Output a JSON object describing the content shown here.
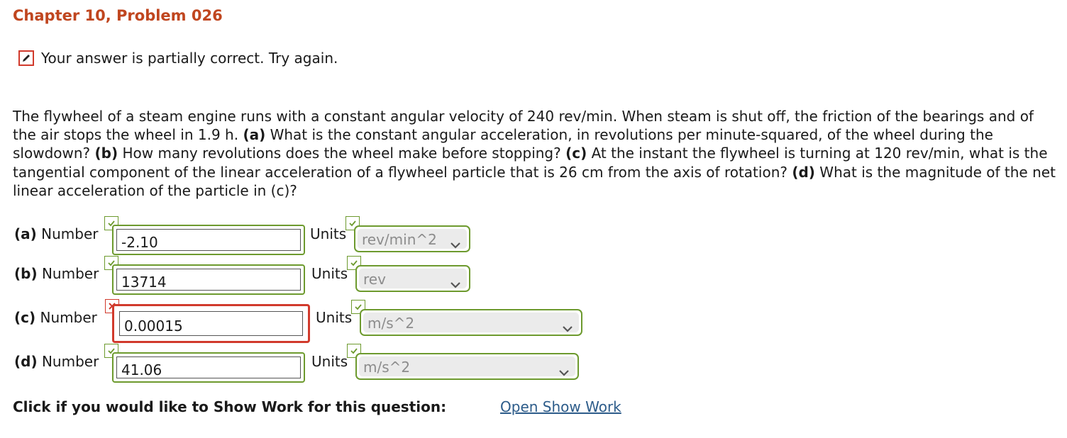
{
  "header": {
    "title": "Chapter 10, Problem 026"
  },
  "status": {
    "message": "Your answer is partially correct.  Try again.",
    "icon": "pencil-icon",
    "color": "#d13a2c"
  },
  "problem": {
    "s1": "The flywheel of a steam engine runs with a constant angular velocity of 240 rev/min. When steam is shut off, the friction of the bearings and of the air stops the wheel in 1.9 h. ",
    "a_tag": "(a)",
    "s2": " What is the constant angular acceleration, in revolutions per minute-squared, of the wheel during the slowdown? ",
    "b_tag": "(b)",
    "s3": " How many revolutions does the wheel make before stopping? ",
    "c_tag": "(c)",
    "s4": " At the instant the flywheel is turning at 120 rev/min, what is the tangential component of the linear acceleration of a flywheel particle that is 26 cm from the axis of rotation? ",
    "d_tag": "(d)",
    "s5": " What is the magnitude of the net linear acceleration of the particle in (c)?"
  },
  "answers": [
    {
      "part": "(a)",
      "number_label": "Number",
      "value": "-2.10",
      "value_status": "correct",
      "units_label": "Units",
      "units_value": "rev/min^2",
      "units_status": "correct"
    },
    {
      "part": "(b)",
      "number_label": "Number",
      "value": "13714",
      "value_status": "correct",
      "units_label": "Units",
      "units_value": "rev",
      "units_status": "correct"
    },
    {
      "part": "(c)",
      "number_label": "Number",
      "value": "0.00015",
      "value_status": "incorrect",
      "units_label": "Units",
      "units_value": "m/s^2",
      "units_status": "correct"
    },
    {
      "part": "(d)",
      "number_label": "Number",
      "value": "41.06",
      "value_status": "correct",
      "units_label": "Units",
      "units_value": "m/s^2",
      "units_status": "correct"
    }
  ],
  "footer": {
    "prompt": "Click if you would like to Show Work for this question:",
    "link": "Open Show Work"
  },
  "colors": {
    "title": "#c0461f",
    "correct": "#6d9a2e",
    "incorrect": "#d13a2c",
    "link": "#2d5c8a"
  }
}
